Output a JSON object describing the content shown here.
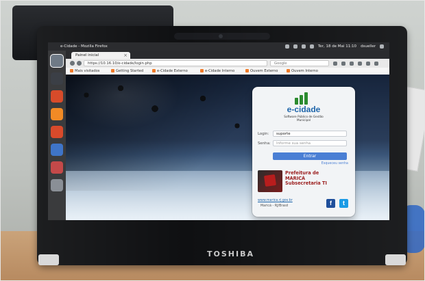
{
  "photo": {
    "laptop_brand": "TOSHIBA"
  },
  "system_topbar": {
    "app_title": "e-Cidade - Mozilla Firefox",
    "clock": "Ter, 18 de Mai 11:10",
    "user": "dsueller"
  },
  "browser": {
    "tab_title": "Painel inicial",
    "url": "https://10.16.10/e-cidade/login.php",
    "search_engine": "Google",
    "bookmarks": [
      {
        "label": "Mais visitados"
      },
      {
        "label": "Getting Started"
      },
      {
        "label": "e-Cidade Externo"
      },
      {
        "label": "e-Cidade Interno"
      },
      {
        "label": "Ouvem Externo"
      },
      {
        "label": "Ouvem Interno"
      }
    ]
  },
  "login_page": {
    "brand_name": "e-cidade",
    "tagline": "Software Público de Gestão Municipal",
    "login_label": "Login:",
    "login_value": "suporte",
    "password_label": "Senha:",
    "password_placeholder": "Informe sua senha",
    "enter_button": "Entrar",
    "forgot_link": "Esqueceu senha",
    "prefeitura_line1": "Prefeitura de",
    "prefeitura_line2": "MARICÁ",
    "prefeitura_line3": "Subsecretaria TI",
    "website": "www.marica.rj.gov.br",
    "city": "Maricá - RJ/Brasil",
    "social": {
      "facebook": "f",
      "twitter": "t"
    },
    "colors": {
      "primary": "#1d64a9",
      "button": "#4a7fd4",
      "prefeitura": "#9b1d1d"
    }
  }
}
